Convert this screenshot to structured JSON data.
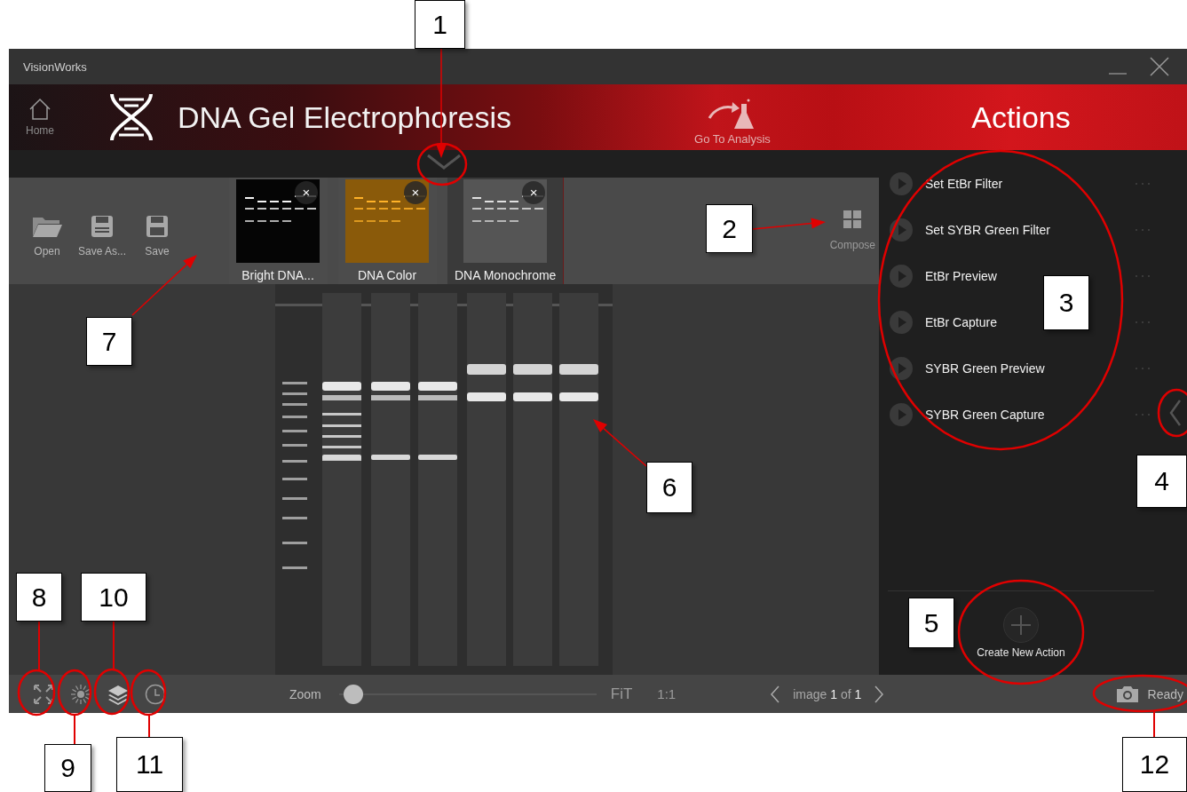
{
  "window": {
    "title": "VisionWorks"
  },
  "header": {
    "home_label": "Home",
    "title": "DNA Gel Electrophoresis",
    "analysis_label": "Go To Analysis",
    "actions_title": "Actions"
  },
  "toolbar": {
    "buttons": [
      {
        "kind": "open",
        "label": "Open"
      },
      {
        "kind": "save_as",
        "label": "Save As..."
      },
      {
        "kind": "save",
        "label": "Save"
      }
    ],
    "compose_label": "Compose"
  },
  "images": [
    {
      "name": "Bright DNA...",
      "kind": "bright",
      "selected": false,
      "close": "×"
    },
    {
      "name": "DNA Color",
      "kind": "color",
      "selected": false,
      "close": "×"
    },
    {
      "name": "DNA Monochrome",
      "kind": "mono",
      "selected": true,
      "close": "×"
    }
  ],
  "actions": [
    {
      "label": "Set EtBr Filter"
    },
    {
      "label": "Set SYBR Green Filter"
    },
    {
      "label": "EtBr Preview"
    },
    {
      "label": "EtBr Capture"
    },
    {
      "label": "SYBR Green Preview"
    },
    {
      "label": "SYBR Green Capture"
    }
  ],
  "create_action": "Create New Action",
  "statusbar": {
    "zoom_label": "Zoom",
    "level": 0.03,
    "fit": "FiT",
    "one_to_one": "1:1",
    "page": "image **1** of **1**",
    "status": "Ready"
  },
  "callouts": [
    "1",
    "2",
    "3",
    "4",
    "5",
    "6",
    "7",
    "8",
    "9",
    "10",
    "11",
    "12"
  ]
}
